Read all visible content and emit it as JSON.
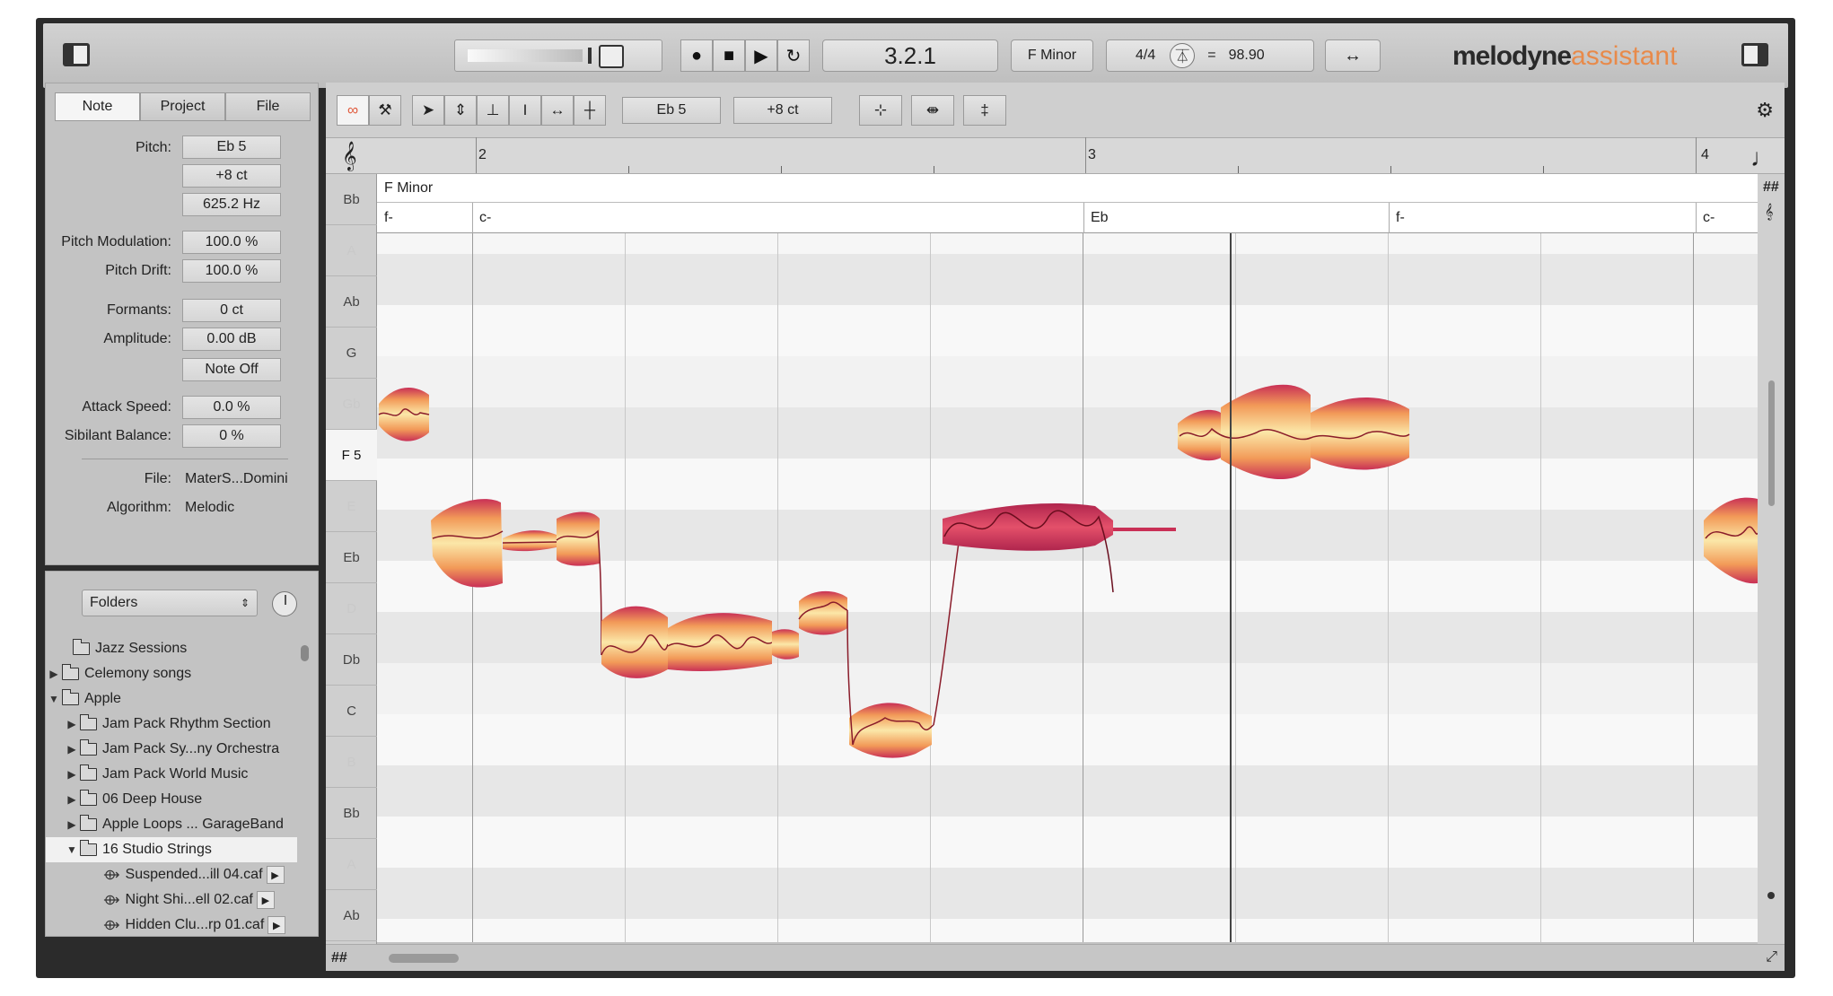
{
  "topbar": {
    "position": "3.2.1",
    "key": "F Minor",
    "time_signature": "4/4",
    "tempo_eq": "=",
    "tempo": "98.90",
    "brand_main": "melodyne",
    "brand_sub": "assistant"
  },
  "inspector": {
    "tabs": [
      "Note",
      "Project",
      "File"
    ],
    "active_tab": "Note",
    "pitch_label": "Pitch:",
    "pitch_note": "Eb 5",
    "pitch_cents": "+8 ct",
    "pitch_hz": "625.2 Hz",
    "pitch_mod_label": "Pitch Modulation:",
    "pitch_mod": "100.0 %",
    "pitch_drift_label": "Pitch Drift:",
    "pitch_drift": "100.0 %",
    "formants_label": "Formants:",
    "formants": "0 ct",
    "amplitude_label": "Amplitude:",
    "amplitude": "0.00 dB",
    "note_off": "Note Off",
    "attack_label": "Attack Speed:",
    "attack": "0.0 %",
    "sibilant_label": "Sibilant Balance:",
    "sibilant": "0 %",
    "file_label": "File:",
    "file": "MaterS...Domini",
    "algorithm_label": "Algorithm:",
    "algorithm": "Melodic"
  },
  "browser": {
    "select": "Folders",
    "items": [
      {
        "label": "Jazz Sessions"
      },
      {
        "label": "Celemony songs"
      },
      {
        "label": "Apple"
      },
      {
        "label": "Jam Pack Rhythm Section"
      },
      {
        "label": "Jam Pack Sy...ny Orchestra"
      },
      {
        "label": "Jam Pack World Music"
      },
      {
        "label": "06 Deep House"
      },
      {
        "label": "Apple Loops ... GarageBand"
      },
      {
        "label": "16 Studio Strings"
      },
      {
        "label": "Suspended...ill 04.caf"
      },
      {
        "label": "Night Shi...ell 02.caf"
      },
      {
        "label": "Hidden Clu...rp 01.caf"
      }
    ]
  },
  "editor": {
    "note_field": "Eb 5",
    "cents_field": "+8 ct",
    "bars": [
      "2",
      "3",
      "4"
    ],
    "key_label": "F Minor",
    "chords": [
      "f-",
      "c-",
      "Eb",
      "f-",
      "c-"
    ],
    "pitches": [
      "Bb",
      "A",
      "Ab",
      "G",
      "Gb",
      "F 5",
      "E",
      "Eb",
      "D",
      "Db",
      "C",
      "B",
      "Bb",
      "A",
      "Ab"
    ],
    "current_pitch": "F 5",
    "hash_symbol": "##"
  },
  "colors": {
    "blob_light": "#fbe7a8",
    "blob_mid": "#f29a58",
    "blob_dark": "#c93056",
    "accent": "#e88a4a"
  }
}
